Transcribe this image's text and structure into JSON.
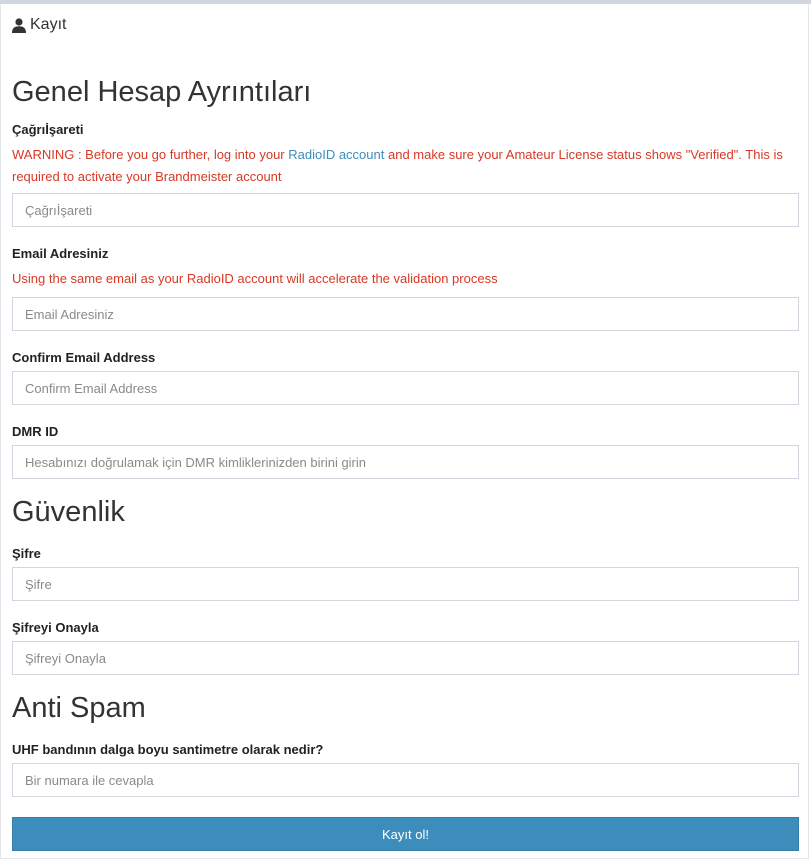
{
  "header": {
    "title": "Kayıt",
    "icon": "user-icon"
  },
  "sections": {
    "general": "Genel Hesap Ayrıntıları",
    "security": "Güvenlik",
    "antispam": "Anti Spam"
  },
  "callsign": {
    "label": "Çağrıİşareti",
    "warning_prefix": "WARNING : Before you go further, log into your ",
    "warning_link": "RadioID account",
    "warning_suffix": " and make sure your Amateur License status shows \"Verified\". This is required to activate your Brandmeister account",
    "placeholder": "Çağrıİşareti",
    "value": ""
  },
  "email": {
    "label": "Email Adresiniz",
    "note": "Using the same email as your RadioID account will accelerate the validation process",
    "placeholder": "Email Adresiniz",
    "value": ""
  },
  "confirm_email": {
    "label": "Confirm Email Address",
    "placeholder": "Confirm Email Address",
    "value": ""
  },
  "dmr_id": {
    "label": "DMR ID",
    "placeholder": "Hesabınızı doğrulamak için DMR kimliklerinizden birini girin",
    "value": ""
  },
  "password": {
    "label": "Şifre",
    "placeholder": "Şifre",
    "value": ""
  },
  "password_confirm": {
    "label": "Şifreyi Onayla",
    "placeholder": "Şifreyi Onayla",
    "value": ""
  },
  "antispam_q": {
    "label": "UHF bandının dalga boyu santimetre olarak nedir?",
    "placeholder": "Bir numara ile cevapla",
    "value": ""
  },
  "submit_label": "Kayıt ol!",
  "colors": {
    "warning": "#d73925",
    "link": "#3c8dbc",
    "button": "#3c8dbc",
    "border": "#d2d6de"
  }
}
